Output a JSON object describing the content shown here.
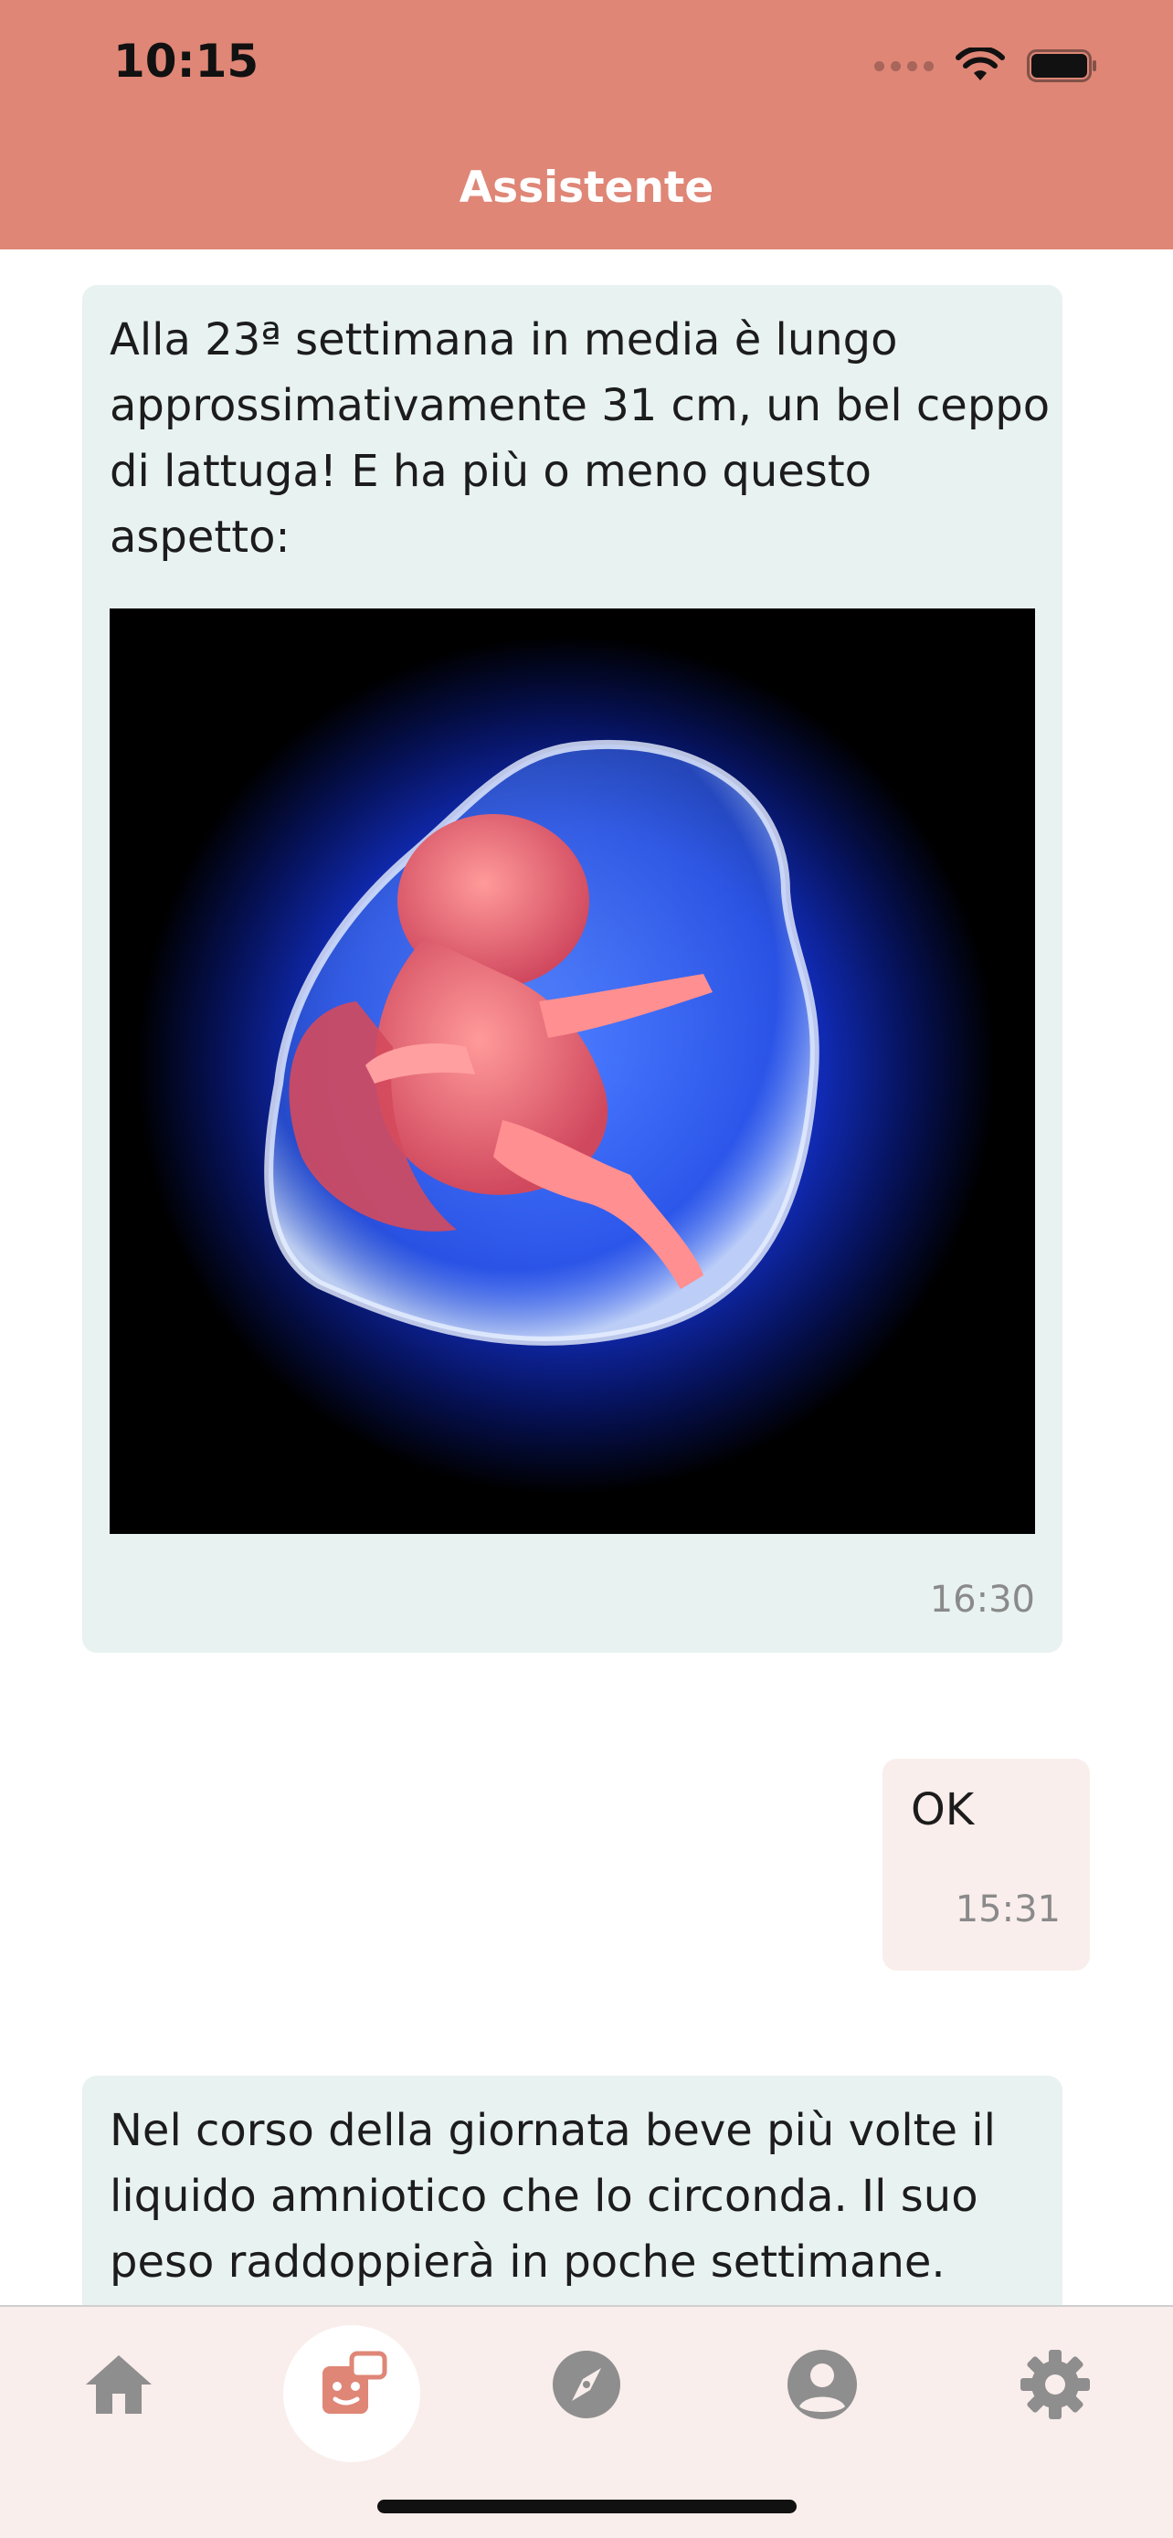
{
  "status_bar": {
    "time": "10:15"
  },
  "header": {
    "title": "Assistente"
  },
  "messages": [
    {
      "from": "assistant",
      "lines": [
        "Alla 23ª settimana in media è lungo",
        "approssimativamente 31 cm, un bel ceppo",
        "di lattuga! E ha più o meno questo",
        "aspetto:"
      ],
      "image": "fetus-illustration",
      "time": "16:30"
    },
    {
      "from": "user",
      "text": "OK",
      "time": "15:31"
    },
    {
      "from": "assistant",
      "lines": [
        "Nel corso della giornata beve più volte il",
        "liquido amniotico che lo circonda. Il suo",
        "peso raddoppierà in poche settimane."
      ]
    }
  ],
  "tabbar": {
    "tabs": [
      {
        "icon": "home-icon",
        "active": false
      },
      {
        "icon": "assistant-robot-icon",
        "active": true
      },
      {
        "icon": "compass-icon",
        "active": false
      },
      {
        "icon": "profile-icon",
        "active": false
      },
      {
        "icon": "gear-icon",
        "active": false
      }
    ]
  },
  "colors": {
    "header": "#DF8676",
    "assistant_bubble": "#E8F2F0",
    "user_bubble": "#F9EEEC",
    "tabbar": "#F9EEEC",
    "tab_icon": "#8E8E8E",
    "accent": "#DF8676"
  }
}
